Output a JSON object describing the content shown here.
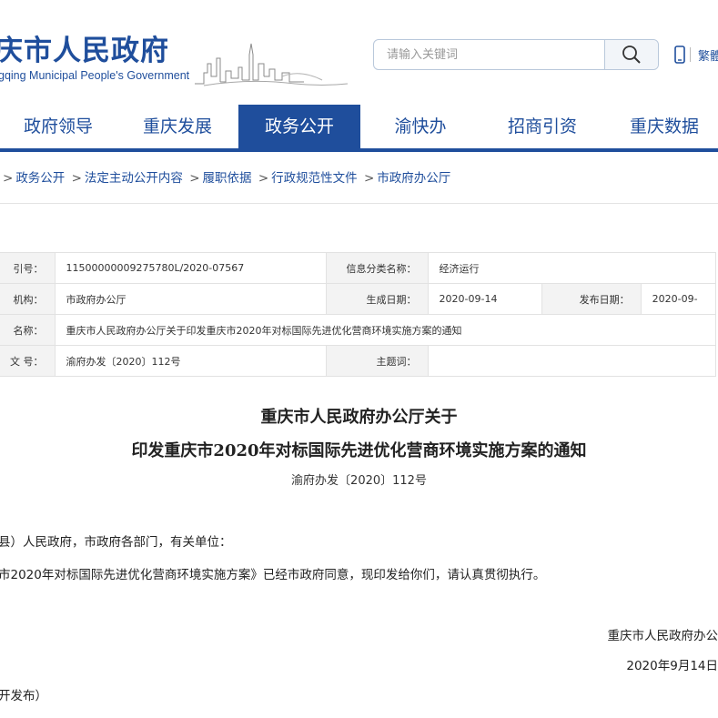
{
  "header": {
    "logo_cn": "庆市人民政府",
    "logo_en": "gqing Municipal People's Government",
    "search_placeholder": "请输入关键词",
    "trad_label": "繁體"
  },
  "nav": {
    "items": [
      "政府领导",
      "重庆发展",
      "政务公开",
      "渝快办",
      "招商引资",
      "重庆数据"
    ],
    "active_index": 2
  },
  "breadcrumb": {
    "items": [
      "政务公开",
      "法定主动公开内容",
      "履职依据",
      "行政规范性文件",
      "市政府办公厅"
    ],
    "separator": ">"
  },
  "meta": {
    "index_label": "引号：",
    "index_value": "11500000009275780L/2020-07567",
    "category_label": "信息分类名称：",
    "category_value": "经济运行",
    "issuer_label": "机构：",
    "issuer_value": "市政府办公厅",
    "created_label": "生成日期：",
    "created_value": "2020-09-14",
    "published_label": "发布日期：",
    "published_value": "2020-09-",
    "name_label": "名称：",
    "name_value": "重庆市人民政府办公厅关于印发重庆市2020年对标国际先进优化营商环境实施方案的通知",
    "docno_label": "文 号：",
    "docno_value": "渝府办发〔2020〕112号",
    "subject_label": "主题词：",
    "subject_value": ""
  },
  "article": {
    "title_line1": "重庆市人民政府办公厅关于",
    "title_line2": "印发重庆市2020年对标国际先进优化营商环境实施方案的通知",
    "doc_number": "渝府办发〔2020〕112号",
    "salutation": "县）人民政府，市政府各部门，有关单位：",
    "body": "市2020年对标国际先进优化营商环境实施方案》已经市政府同意，现印发给你们，请认真贯彻执行。",
    "signer": "重庆市人民政府办公",
    "date": "2020年9月14日",
    "footer_note": "开发布）"
  }
}
